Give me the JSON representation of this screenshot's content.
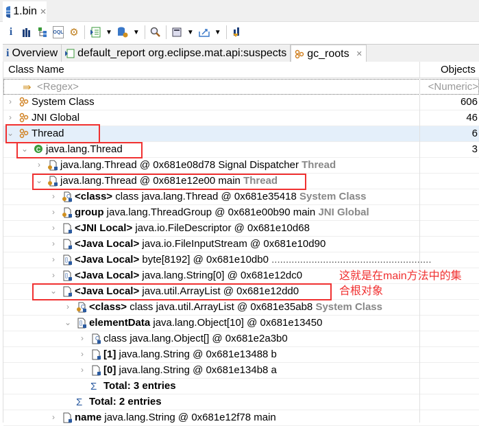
{
  "editor_tab": {
    "title": "1.bin",
    "icon": "heap-dump-icon"
  },
  "toolbar": {
    "icons": [
      "info-icon",
      "histogram-icon",
      "dominator-tree-icon",
      "oql-icon",
      "thread-overview-icon",
      "reports-icon",
      "query-browser-icon",
      "search-icon",
      "calculator-icon",
      "export-icon",
      "leak-suspects-icon"
    ]
  },
  "tabs": [
    {
      "label": "Overview",
      "icon": "info-icon"
    },
    {
      "label": "default_report  org.eclipse.mat.api:suspects",
      "icon": "report-icon"
    },
    {
      "label": "gc_roots",
      "icon": "gc-roots-icon",
      "active": true
    }
  ],
  "columns": {
    "class_name": "Class Name",
    "objects": "Objects"
  },
  "filter": {
    "class_placeholder": "<Regex>",
    "objects_placeholder": "<Numeric>"
  },
  "rows": [
    {
      "level": 0,
      "exp": "closed",
      "icon": "gc",
      "text": "System Class",
      "obj": "606"
    },
    {
      "level": 0,
      "exp": "closed",
      "icon": "gc",
      "text": "JNI Global",
      "obj": "46"
    },
    {
      "level": 0,
      "exp": "open",
      "icon": "gc",
      "text": "Thread",
      "obj": "6",
      "sel": true
    },
    {
      "level": 1,
      "exp": "open",
      "icon": "class-green",
      "text": "java.lang.Thread",
      "obj": "3"
    },
    {
      "level": 2,
      "exp": "closed",
      "icon": "obj-o",
      "text": "java.lang.Thread @ 0x681e08d78  Signal Dispatcher ",
      "suffix": "Thread"
    },
    {
      "level": 2,
      "exp": "open",
      "icon": "obj-o",
      "text": "java.lang.Thread @ 0x681e12e00  main ",
      "suffix": "Thread"
    },
    {
      "level": 3,
      "exp": "closed",
      "icon": "class-o",
      "prefix": "<class>",
      "text": " class java.lang.Thread @ 0x681e35418 ",
      "suffix": "System Class"
    },
    {
      "level": 3,
      "exp": "closed",
      "icon": "obj-o",
      "prefix": "group",
      "text": " java.lang.ThreadGroup @ 0x681e00b90  main ",
      "suffix": "JNI Global"
    },
    {
      "level": 3,
      "exp": "closed",
      "icon": "obj",
      "prefix": "<JNI Local>",
      "text": " java.io.FileDescriptor @ 0x681e10d68"
    },
    {
      "level": 3,
      "exp": "closed",
      "icon": "obj",
      "prefix": "<Java Local>",
      "text": " java.io.FileInputStream @ 0x681e10d90"
    },
    {
      "level": 3,
      "exp": "closed",
      "icon": "array",
      "prefix": "<Java Local>",
      "text": " byte[8192] @ 0x681e10db0  ",
      "dots": "........................................................"
    },
    {
      "level": 3,
      "exp": "closed",
      "icon": "array",
      "prefix": "<Java Local>",
      "text": " java.lang.String[0] @ 0x681e12dc0"
    },
    {
      "level": 3,
      "exp": "open",
      "icon": "obj",
      "prefix": "<Java Local>",
      "text": " java.util.ArrayList @ 0x681e12dd0"
    },
    {
      "level": 4,
      "exp": "closed",
      "icon": "class-o",
      "prefix": "<class>",
      "text": " class java.util.ArrayList @ 0x681e35ab8 ",
      "suffix": "System Class"
    },
    {
      "level": 4,
      "exp": "open",
      "icon": "array",
      "prefix": "elementData",
      "text": " java.lang.Object[10] @ 0x681e13450"
    },
    {
      "level": 5,
      "exp": "closed",
      "icon": "class",
      "text": " class java.lang.Object[] @ 0x681e2a3b0"
    },
    {
      "level": 5,
      "exp": "closed",
      "icon": "obj",
      "prefix": "[1]",
      "text": " java.lang.String @ 0x681e13488  b"
    },
    {
      "level": 5,
      "exp": "closed",
      "icon": "obj",
      "prefix": "[0]",
      "text": " java.lang.String @ 0x681e134b8  a"
    },
    {
      "level": 5,
      "exp": "none",
      "icon": "sigma",
      "prefix": "Total: 3 entries",
      "text": ""
    },
    {
      "level": 4,
      "exp": "none",
      "icon": "sigma",
      "prefix": "Total: 2 entries",
      "text": ""
    },
    {
      "level": 3,
      "exp": "closed",
      "icon": "obj",
      "prefix": "name",
      "text": " java.lang.String @ 0x681e12f78  main"
    }
  ],
  "annotation": {
    "line1": "这就是在main方法中的集",
    "line2": "合根对象",
    "color": "#f03030"
  }
}
